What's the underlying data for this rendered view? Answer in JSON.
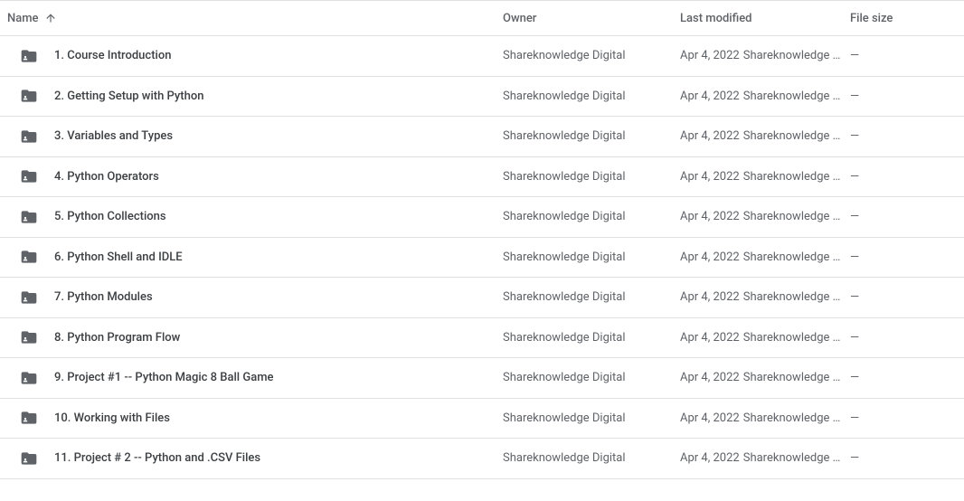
{
  "columns": {
    "name": "Name",
    "owner": "Owner",
    "modified": "Last modified",
    "filesize": "File size"
  },
  "sort": {
    "column": "name",
    "direction": "asc"
  },
  "files": [
    {
      "name": "1. Course Introduction",
      "owner": "Shareknowledge Digital",
      "modified_date": "Apr 4, 2022",
      "modified_by": "Shareknowledge D…",
      "size": "—"
    },
    {
      "name": "2. Getting Setup with Python",
      "owner": "Shareknowledge Digital",
      "modified_date": "Apr 4, 2022",
      "modified_by": "Shareknowledge D…",
      "size": "—"
    },
    {
      "name": "3. Variables and Types",
      "owner": "Shareknowledge Digital",
      "modified_date": "Apr 4, 2022",
      "modified_by": "Shareknowledge D…",
      "size": "—"
    },
    {
      "name": "4. Python Operators",
      "owner": "Shareknowledge Digital",
      "modified_date": "Apr 4, 2022",
      "modified_by": "Shareknowledge D…",
      "size": "—"
    },
    {
      "name": "5. Python Collections",
      "owner": "Shareknowledge Digital",
      "modified_date": "Apr 4, 2022",
      "modified_by": "Shareknowledge D…",
      "size": "—"
    },
    {
      "name": "6. Python Shell and IDLE",
      "owner": "Shareknowledge Digital",
      "modified_date": "Apr 4, 2022",
      "modified_by": "Shareknowledge D…",
      "size": "—"
    },
    {
      "name": "7. Python Modules",
      "owner": "Shareknowledge Digital",
      "modified_date": "Apr 4, 2022",
      "modified_by": "Shareknowledge D…",
      "size": "—"
    },
    {
      "name": "8. Python Program Flow",
      "owner": "Shareknowledge Digital",
      "modified_date": "Apr 4, 2022",
      "modified_by": "Shareknowledge D…",
      "size": "—"
    },
    {
      "name": "9. Project #1 -- Python Magic 8 Ball Game",
      "owner": "Shareknowledge Digital",
      "modified_date": "Apr 4, 2022",
      "modified_by": "Shareknowledge D…",
      "size": "—"
    },
    {
      "name": "10. Working with Files",
      "owner": "Shareknowledge Digital",
      "modified_date": "Apr 4, 2022",
      "modified_by": "Shareknowledge D…",
      "size": "—"
    },
    {
      "name": "11. Project # 2 -- Python and .CSV Files",
      "owner": "Shareknowledge Digital",
      "modified_date": "Apr 4, 2022",
      "modified_by": "Shareknowledge D…",
      "size": "—"
    }
  ]
}
